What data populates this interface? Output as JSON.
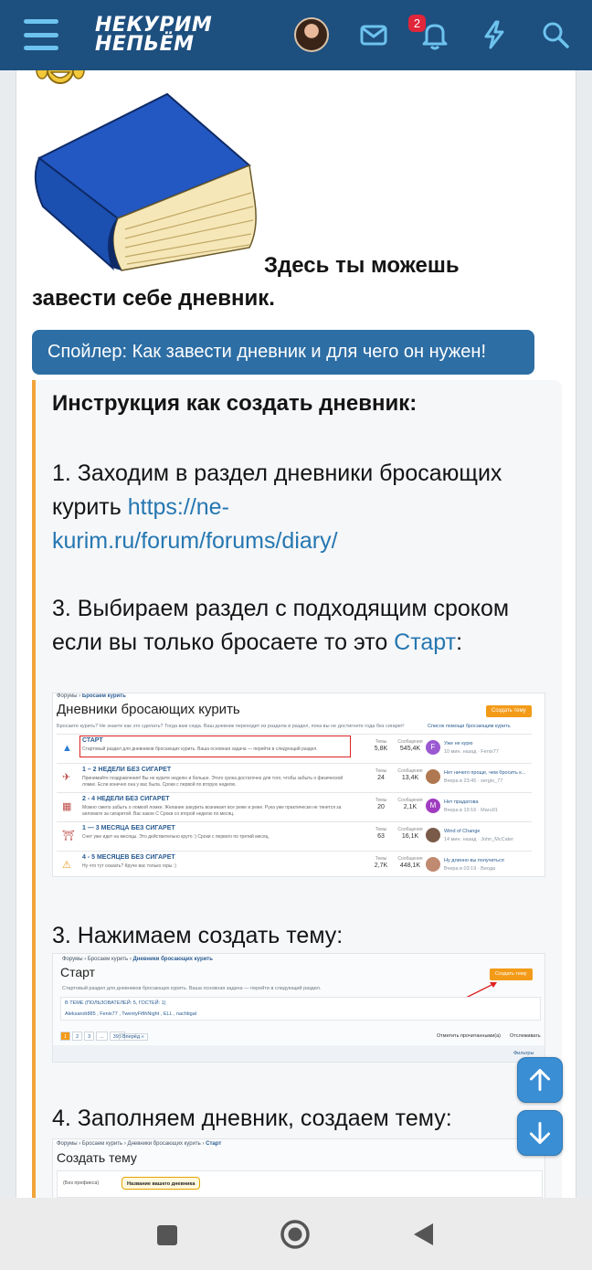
{
  "header": {
    "logo_line1": "НЕКУРИМ",
    "logo_line2": "НЕПЬЁМ",
    "notification_count": "2"
  },
  "post": {
    "intro_line1": "Здесь ты можешь",
    "intro_line2": "завести себе дневник.",
    "spoiler_label": "Спойлер: Как завести дневник и для чего он нужен!",
    "spoiler_title": "Инструкция как создать дневник:",
    "step1_line1": "1. Заходим в раздел дневники бросающих",
    "step1_line2_prefix": "курить ",
    "step1_link_part1": "https://ne-",
    "step1_link_part2": "kurim.ru/forum/forums/diary/",
    "step2_line1": "3. Выбираем раздел с подходящим сроком",
    "step2_line2_prefix": "если вы только бросаете то это ",
    "step2_link": "Старт",
    "step2_suffix": ":",
    "step3": "3. Нажимаем создать тему:",
    "step4": "4. Заполняем дневник, создаем тему:"
  },
  "shot1": {
    "crumb1": "Форумы",
    "crumb2": "Бросаем курить",
    "title": "Дневники бросающих курить",
    "button": "Создать тему",
    "desc": "Бросаете курить? Не знаете как это сделать? Тогда вам сюда. Ваш дневник переходит из раздела в раздел, пока вы не достигнете года без сигарет!",
    "help_link": "Список помощи бросающим курить",
    "rows": [
      {
        "title": "СТАРТ",
        "desc": "Стартовый раздел для дневников бросающих курить. Ваша основная задача — перейти в следующий раздел.",
        "topics": "5,8K",
        "posts": "545,4K",
        "avatar": "F",
        "last_title": "Уже не курю",
        "last_meta": "10 мин. назад · Fenix77",
        "color": "#9b59d0"
      },
      {
        "title": "1 – 2 НЕДЕЛИ БЕЗ СИГАРЕТ",
        "desc": "Принимайте поздравления! Вы не курите неделю и больше. Этого срока достаточно для того, чтобы забыть о физической ломке. Если конечно она у вас была. Сроки с первой по вторую неделю.",
        "topics": "24",
        "posts": "13,4K",
        "avatar": "",
        "last_title": "Нет ничего проще, чем бросить к...",
        "last_meta": "Вчера в 23:45 · sergio_77",
        "color": "#b07850"
      },
      {
        "title": "2 - 4 НЕДЕЛИ БЕЗ СИГАРЕТ",
        "desc": "Можно смело забыть о ломкой ломке. Желание закурить возникает все реже и реже. Рука уже практически не тянется за аяломате за сигаретой. Вас какое С Сроки со второй неделю по месяц.",
        "topics": "20",
        "posts": "2,1K",
        "avatar": "M",
        "last_title": "Нет прадатова",
        "last_meta": "Вчера в 19:16 · Maru91",
        "color": "#a03cc0"
      },
      {
        "title": "1 — 3 МЕСЯЦА БЕЗ СИГАРЕТ",
        "desc": "Счет уже идет на месяцы. Это действительно круто :) Сроки с первого по третий месяц.",
        "topics": "63",
        "posts": "16,1K",
        "avatar": "",
        "last_title": "Wind of Change",
        "last_meta": "14 мин. назад · John_McCater",
        "color": "#7a5a48"
      },
      {
        "title": "4 - 5 МЕСЯЦЕВ БЕЗ СИГАРЕТ",
        "desc": "Ну что тут сказать? Круче вас только горы :)",
        "topics": "2,7K",
        "posts": "448,1K",
        "avatar": "",
        "last_title": "Ну длинно вы получиться",
        "last_meta": "Вчера в 03:19 · Веода",
        "color": "#c08a70"
      }
    ],
    "col_topics": "Темы",
    "col_posts": "Сообщения"
  },
  "shot2": {
    "crumb1": "Форумы",
    "crumb2": "Бросаем курить",
    "crumb3": "Дневники бросающих курить",
    "title": "Старт",
    "button": "Создать тему",
    "desc": "Стартовый раздел для дневников бросающих курить. Ваша основная задача — перейти в следующий раздел.",
    "online_label": "В ТЕМЕ (ПОЛЬЗОВАТЕЛЕЙ: 5, ГОСТЕЙ: 1)",
    "online_users": "Aleksandr885 , Fenix77 , TwentyFifthNight , ELL , nachtigal",
    "pages": [
      "1",
      "2",
      "3",
      "...",
      "395"
    ],
    "next": "Вперёд »",
    "mark_read": "Отметить прочитанными(а)",
    "watch": "Отслеживать",
    "filters": "Фильтры"
  },
  "shot3": {
    "crumb1": "Форумы",
    "crumb2": "Бросаем курить",
    "crumb3": "Дневники бросающих курить",
    "crumb4": "Старт",
    "title": "Создать тему",
    "prefix": "(Без префикса)",
    "input": "Название вашего дневника"
  },
  "colors": {
    "header": "#1d4f7f",
    "accent": "#6dc3ee",
    "spoiler": "#2d6ea5",
    "link": "#2577b1",
    "quote_bar": "#f1a43a"
  }
}
